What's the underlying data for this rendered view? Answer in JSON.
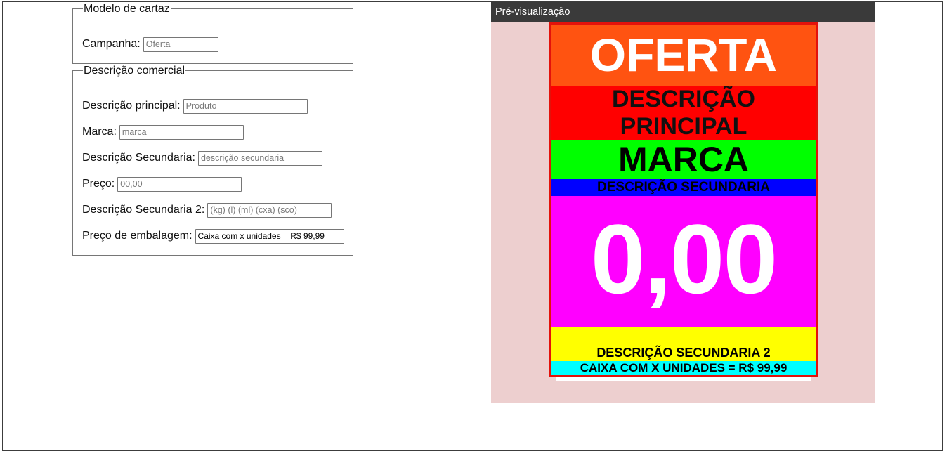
{
  "form": {
    "modelo": {
      "legend": "Modelo de cartaz",
      "campanha": {
        "label": "Campanha:",
        "placeholder": "Oferta",
        "value": ""
      }
    },
    "descricao": {
      "legend": "Descrição comercial",
      "principal": {
        "label": "Descrição principal:",
        "placeholder": "Produto",
        "value": ""
      },
      "marca": {
        "label": "Marca:",
        "placeholder": "marca",
        "value": ""
      },
      "secundaria": {
        "label": "Descrição Secundaria:",
        "placeholder": "descrição secundaria",
        "value": ""
      },
      "preco": {
        "label": "Preço:",
        "placeholder": "00,00",
        "value": ""
      },
      "secundaria2": {
        "label": "Descrição Secundaria 2:",
        "placeholder": "(kg) (l) (ml) (cxa) (sco)",
        "value": ""
      },
      "embalagem": {
        "label": "Preço de embalagem:",
        "placeholder": "",
        "value": "Caixa com x unidades = R$ 99,99"
      }
    }
  },
  "preview": {
    "header": "Pré-visualização",
    "poster": {
      "campanha": "OFERTA",
      "descricao_principal": "DESCRIÇÃO PRINCIPAL",
      "marca": "MARCA",
      "descricao_secundaria": "DESCRIÇÃO SECUNDARIA",
      "preco": "0,00",
      "descricao_secundaria_2": "DESCRIÇÃO SECUNDARIA 2",
      "preco_embalagem": "CAIXA COM X UNIDADES = R$ 99,99"
    }
  },
  "colors": {
    "oferta_band": "#ff5311",
    "descricao_band": "#ff0000",
    "marca_band": "#00ff00",
    "secundaria_band": "#0000ff",
    "preco_band": "#ff00ff",
    "secundaria2_band": "#ffff00",
    "embalagem_band": "#00ffff",
    "poster_border": "#e3120b",
    "preview_background": "#edcfcf",
    "preview_header": "#3a3a3a"
  }
}
